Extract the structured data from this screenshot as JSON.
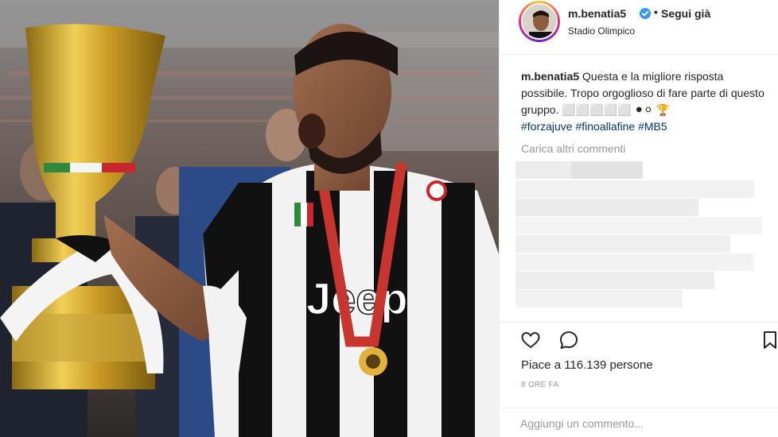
{
  "header": {
    "username": "m.benatia5",
    "separator": "•",
    "follow_label": "Segui già",
    "location": "Stadio Olimpico"
  },
  "caption": {
    "username": "m.benatia5",
    "text": " Questa e la migliore risposta possibile. Tropo orgoglioso di fare parte di questo gruppo. ⬜⬜⬜⬜⬜ ⚫⚪ 🏆",
    "hashtags": [
      "#forzajuve",
      "#finoallafine",
      "#MB5"
    ]
  },
  "load_more_label": "Carica altri commenti",
  "likes_text": "Piace a 116.139 persone",
  "timestamp": "8 ORE FA",
  "comment_input": {
    "placeholder": "Aggiungi un commento...",
    "value": ""
  },
  "icons": {
    "verified": "verified-badge-icon",
    "like": "heart-icon",
    "comment": "comment-bubble-icon",
    "save": "bookmark-icon"
  },
  "colors": {
    "text": "#262626",
    "muted": "#999999",
    "hashtag": "#003569",
    "verified": "#3897f0",
    "border": "#efefef"
  }
}
